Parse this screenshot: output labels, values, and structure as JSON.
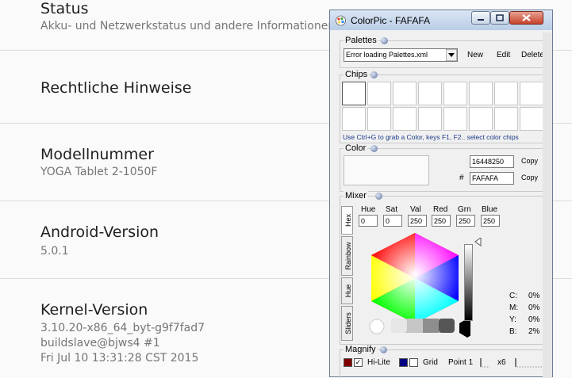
{
  "settings": {
    "items": [
      {
        "title": "Status",
        "subtitle": "Akku- und Netzwerkstatus und andere Informationen"
      },
      {
        "title": "Rechtliche Hinweise"
      },
      {
        "title": "Modellnummer",
        "subtitle": "YOGA Tablet 2-1050F"
      },
      {
        "title": "Android-Version",
        "subtitle": "5.0.1"
      },
      {
        "title": "Kernel-Version",
        "lines": [
          "3.10.20-x86_64_byt-g9f7fad7",
          "buildslave@bjws4 #1",
          "Fri Jul 10 13:31:28 CST 2015"
        ]
      }
    ]
  },
  "colorpic": {
    "title": "ColorPic - FAFAFA",
    "palettes": {
      "label": "Palettes",
      "select_value": "Error loading Palettes.xml",
      "new_label": "New",
      "edit_label": "Edit",
      "delete_label": "Delete"
    },
    "chips": {
      "label": "Chips",
      "hint": "Use Ctrl+G to grab a Color, keys F1, F2.. select color chips"
    },
    "color": {
      "label": "Color",
      "decimal_value": "16448250",
      "hex_prefix": "#",
      "hex_value": "FAFAFA",
      "copy_label": "Copy",
      "preview_color": "#fafafa"
    },
    "mixer": {
      "label": "Mixer",
      "tabs": [
        "Hex",
        "Rainbow",
        "Hue",
        "Sliders"
      ],
      "fields": [
        {
          "label": "Hue",
          "value": "0"
        },
        {
          "label": "Sat",
          "value": "0"
        },
        {
          "label": "Val",
          "value": "250"
        },
        {
          "label": "Red",
          "value": "250"
        },
        {
          "label": "Grn",
          "value": "250"
        },
        {
          "label": "Blue",
          "value": "250"
        }
      ],
      "cmyk": [
        {
          "label": "C:",
          "value": "0%"
        },
        {
          "label": "M:",
          "value": "0%"
        },
        {
          "label": "Y:",
          "value": "0%"
        },
        {
          "label": "B:",
          "value": "2%"
        }
      ]
    },
    "magnify": {
      "label": "Magnify",
      "hilite_label": "Hi-Lite",
      "grid_label": "Grid",
      "point_label": "Point 1",
      "zoom_label": "x6",
      "hilite_color": "#800000",
      "grid_color": "#000080"
    }
  }
}
